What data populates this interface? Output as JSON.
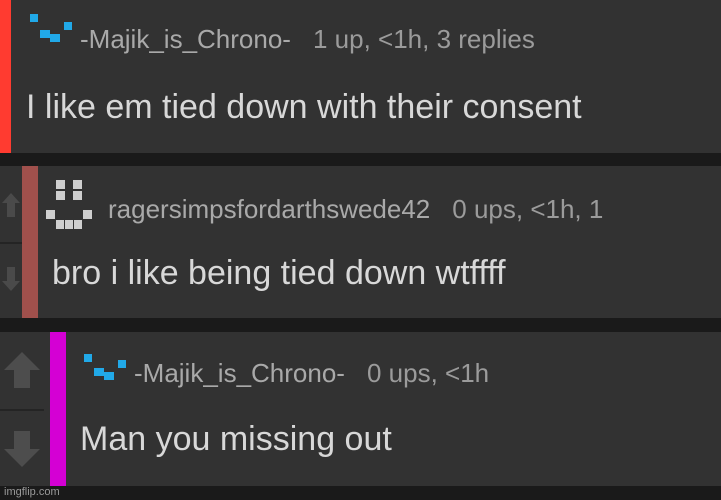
{
  "comments": [
    {
      "username": "-Majik_is_Chrono-",
      "stats": "1 up, <1h, 3 replies",
      "text": "I like em tied down with their consent",
      "accent_color": "#ff3b30",
      "avatar_icon": "pixel-avatar-icon"
    },
    {
      "username": "ragersimpsfordarthswede42",
      "stats": "0 ups, <1h, 1",
      "text": "bro i like being tied down wtffff",
      "accent_color": "#a0504c",
      "avatar_icon": "smiley-pixel-avatar-icon"
    },
    {
      "username": "-Majik_is_Chrono-",
      "stats": "0 ups, <1h",
      "text": "Man you missing out",
      "accent_color": "#d400d4",
      "avatar_icon": "pixel-avatar-icon"
    }
  ],
  "watermark": "imgflip.com",
  "colors": {
    "background": "#1a1a1a",
    "card": "#323232",
    "avatar_blue": "#21a9e8"
  }
}
